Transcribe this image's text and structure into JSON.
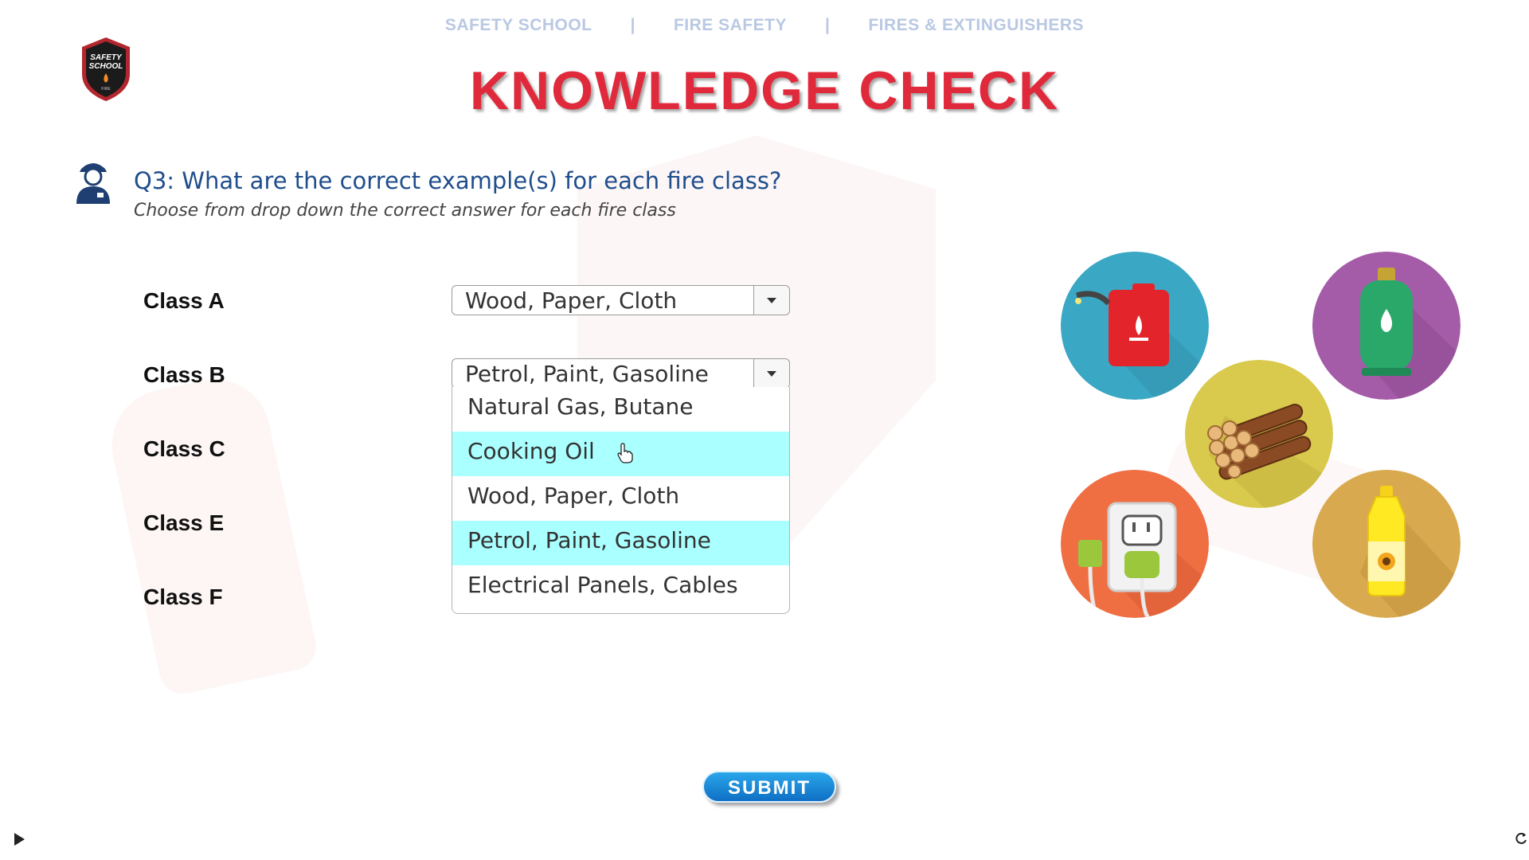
{
  "breadcrumb": {
    "items": [
      "SAFETY SCHOOL",
      "FIRE SAFETY",
      "FIRES & EXTINGUISHERS"
    ],
    "separator": "|"
  },
  "logo": {
    "text_line1": "SAFETY",
    "text_line2": "SCHOOL",
    "text_line3": "FIRE"
  },
  "title": "KNOWLEDGE CHECK",
  "question": {
    "text": "Q3: What are the correct example(s) for each fire class?",
    "instruction": "Choose from drop down the correct answer for each fire class"
  },
  "classes": [
    {
      "label": "Class A",
      "selected": "Wood, Paper, Cloth"
    },
    {
      "label": "Class B",
      "selected": "Petrol, Paint, Gasoline"
    },
    {
      "label": "Class C",
      "selected": ""
    },
    {
      "label": "Class E",
      "selected": ""
    },
    {
      "label": "Class F",
      "selected": ""
    }
  ],
  "dropdown_options": [
    "Natural Gas, Butane",
    "Cooking Oil",
    "Wood, Paper, Cloth",
    "Petrol, Paint, Gasoline",
    "Electrical Panels, Cables"
  ],
  "icons": [
    {
      "name": "fuel-can-icon",
      "bg": "#3aa7c4"
    },
    {
      "name": "gas-cylinder-icon",
      "bg": "#a55ca8"
    },
    {
      "name": "firewood-icon",
      "bg": "#d9c94d"
    },
    {
      "name": "electrical-outlet-icon",
      "bg": "#ef6f43"
    },
    {
      "name": "cooking-oil-bottle-icon",
      "bg": "#d9a94f"
    }
  ],
  "submit_label": "SUBMIT",
  "colors": {
    "title": "#e02a3b",
    "question": "#1f4e8c",
    "breadcrumb": "#b9c8e3",
    "highlight": "#aaffff",
    "submit": "#1a8ad8"
  }
}
